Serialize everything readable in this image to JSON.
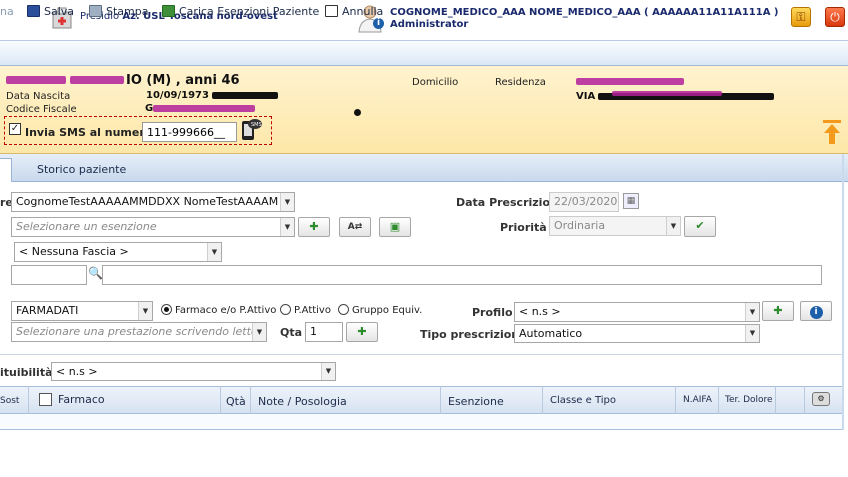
{
  "header": {
    "presidio_label": "Presidio",
    "presidio_name": "Az. USL Toscana nord-ovest",
    "doctor_name": "COGNOME_MEDICO_AAA NOME_MEDICO_AAA ( AAAAAA11A11A111A )",
    "doctor_role": "Administrator"
  },
  "toolbar": {
    "partial_label": "na",
    "save_label": "Salva",
    "print_label": "Stampa",
    "load_exemptions_label": "Carica Esenzioni Paziente",
    "cancel_label": "Annulla"
  },
  "patient": {
    "name_suffix": "IO (M) , anni 46",
    "birth_date_label": "Data Nascita",
    "birth_date": "10/09/1973",
    "fiscal_code_label": "Codice Fiscale",
    "fiscal_code_prefix": "G",
    "domicile_label": "Domicilio",
    "residence_label": "Residenza",
    "address_prefix": "VIA",
    "sms_label": "Invia SMS al numero",
    "sms_number": "111-999666__",
    "sms_checked": true
  },
  "tabs": {
    "history_label": "Storico paziente"
  },
  "form": {
    "patient_row_label": "re",
    "patient_select": "CognomeTestAAAAAMMDDXX NomeTestAAAAM",
    "exemption_placeholder": "Selezionare un esenzione",
    "band_select": "< Nessuna Fascia >",
    "prescription_date_label": "Data Prescrizioni",
    "prescription_date": "22/03/2020",
    "priority_label": "Priorità",
    "priority_value": "Ordinaria",
    "source_select": "FARMADATI",
    "radio_drug": "Farmaco e/o P.Attivo",
    "radio_active": "P.Attivo",
    "radio_group": "Gruppo Equiv.",
    "profile_label": "Profilo",
    "profile_value": "< n.s >",
    "service_placeholder": "Selezionare una prestazione scrivendo lettere",
    "qty_label": "Qta",
    "qty_value": "1",
    "prescription_type_label": "Tipo prescrizione",
    "prescription_type_value": "Automatico"
  },
  "filter": {
    "label": "ituibilità:",
    "value": "< n.s >"
  },
  "grid": {
    "columns": [
      "Sost",
      "Farmaco",
      "Qtà",
      "Note / Posologia",
      "Esenzione",
      "Classe e Tipo",
      "N.AIFA",
      "Ter. Dolore"
    ]
  },
  "colors": {
    "patient_band": "#fde7a8",
    "toolbar": "#dbe7f5",
    "accent_blue": "#1d5fa8",
    "redaction": "#b0209a"
  }
}
